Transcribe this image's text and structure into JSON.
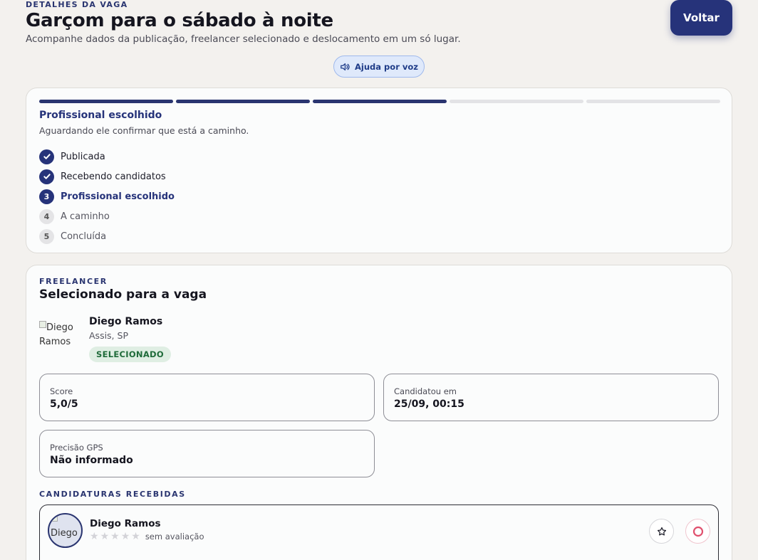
{
  "header": {
    "eyebrow": "DETALHES DA VAGA",
    "title": "Garçom para o sábado à noite",
    "subtitle": "Acompanhe dados da publicação, freelancer selecionado e deslocamento em um só lugar.",
    "back_label": "Voltar",
    "voice_help_label": "Ajuda por voz"
  },
  "status": {
    "progress": {
      "completed": 3,
      "total": 5
    },
    "title": "Profissional escolhido",
    "description": "Aguardando ele confirmar que está a caminho.",
    "steps": [
      {
        "number": "1",
        "label": "Publicada",
        "state": "done"
      },
      {
        "number": "2",
        "label": "Recebendo candidatos",
        "state": "done"
      },
      {
        "number": "3",
        "label": "Profissional escolhido",
        "state": "current"
      },
      {
        "number": "4",
        "label": "A caminho",
        "state": "pending"
      },
      {
        "number": "5",
        "label": "Concluída",
        "state": "pending"
      }
    ]
  },
  "freelancer": {
    "eyebrow": "FREELANCER",
    "title": "Selecionado para a vaga",
    "avatar_alt": "Diego Ramos",
    "name": "Diego Ramos",
    "city": "Assis, SP",
    "badge": "SELECIONADO",
    "stats": {
      "score": {
        "label": "Score",
        "value": "5,0/5"
      },
      "applied": {
        "label": "Candidatou em",
        "value": "25/09, 00:15"
      },
      "gps": {
        "label": "Precisão GPS",
        "value": "Não informado"
      }
    }
  },
  "applications": {
    "eyebrow": "CANDIDATURAS RECEBIDAS",
    "items": [
      {
        "avatar_alt": "Diego",
        "name": "Diego Ramos",
        "stars": 0,
        "rating_text": "sem avaliação"
      }
    ]
  },
  "colors": {
    "primary": "#26337a",
    "background": "#f3f1ee",
    "badge_bg": "#dfeee3",
    "badge_text": "#1f6b3a",
    "reject": "#e0506e"
  },
  "icons": {
    "voice": "speaker-icon",
    "check": "check-icon",
    "favorite": "star-icon",
    "reject": "ring-icon"
  }
}
